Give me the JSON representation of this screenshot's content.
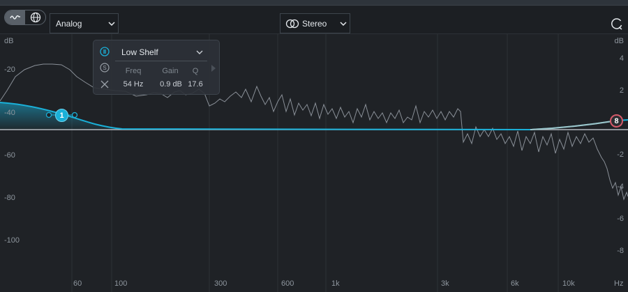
{
  "toolbar": {
    "mode_buttons": [
      {
        "icon": "waveform-icon",
        "active": true
      },
      {
        "icon": "globe-icon",
        "active": false
      }
    ],
    "processing_mode": "Analog",
    "channel_mode": "Stereo",
    "channel_icon": "stereo-link-icon",
    "refresh_icon": "refresh-icon"
  },
  "graph": {
    "left_unit": "dB",
    "right_unit": "dB",
    "left_ticks": [
      "-20",
      "-40",
      "-60",
      "-80",
      "-100"
    ],
    "right_ticks": [
      "4",
      "2",
      "0",
      "-2",
      "-4",
      "-6",
      "-8"
    ],
    "freq_ticks": [
      "60",
      "100",
      "300",
      "600",
      "1k",
      "3k",
      "6k",
      "10k",
      "Hz"
    ],
    "colors": {
      "eq_curve": "#1ab0d8",
      "spectrum": "#8a9098",
      "zero_line": "#cfd5db",
      "node_selected": "#1ab0d8",
      "node_8": "#d65a6a"
    }
  },
  "band_popup": {
    "filter_type": "Low Shelf",
    "icons": [
      "power-icon",
      "solo-icon",
      "remove-icon",
      "next-arrow-icon"
    ],
    "params": [
      {
        "label": "Freq",
        "value": "54 Hz"
      },
      {
        "label": "Gain",
        "value": "0.9 dB"
      },
      {
        "label": "Q",
        "value": "17.6"
      }
    ]
  },
  "nodes": [
    {
      "label": "1",
      "band": "low-shelf",
      "selected": true
    },
    {
      "label": "8",
      "band": "high",
      "selected": false
    }
  ]
}
